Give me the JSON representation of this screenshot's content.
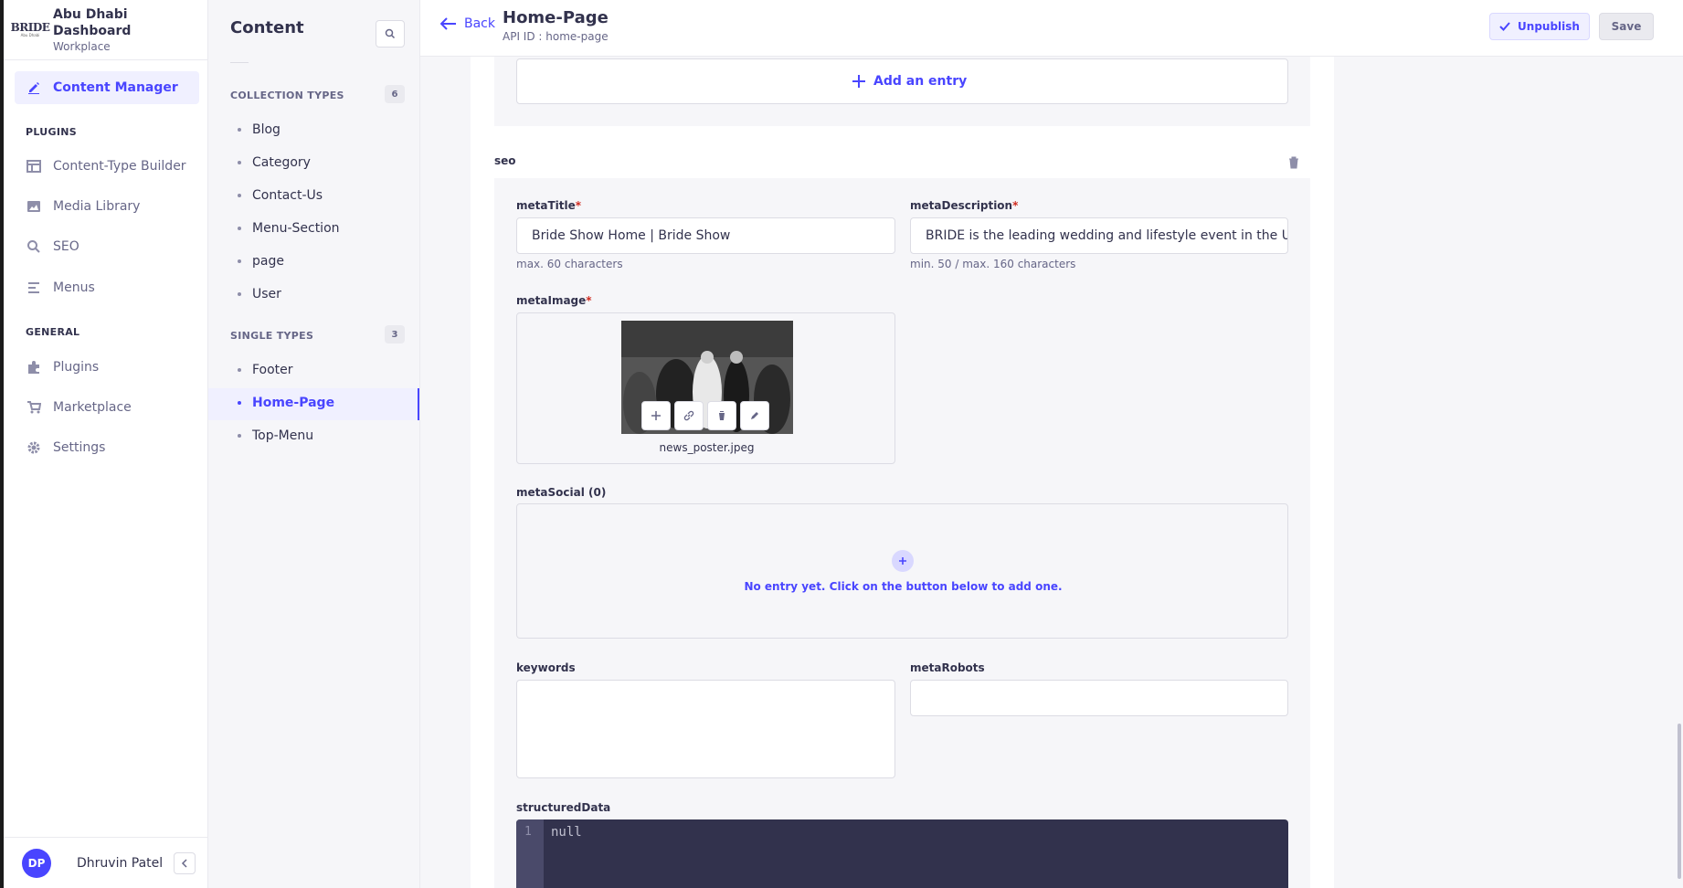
{
  "brand": {
    "logo_main": "BRIDE",
    "logo_sub": "Abu Dhabi",
    "title": "Abu Dhabi Dashboard",
    "subtitle": "Workplace"
  },
  "mainnav": {
    "active": "Content Manager",
    "plugins_heading": "PLUGINS",
    "plugins": [
      "Content-Type Builder",
      "Media Library",
      "SEO",
      "Menus"
    ],
    "general_heading": "GENERAL",
    "general": [
      "Plugins",
      "Marketplace",
      "Settings"
    ]
  },
  "user": {
    "initials": "DP",
    "name": "Dhruvin Patel"
  },
  "subnav": {
    "title": "Content",
    "collection_heading": "COLLECTION TYPES",
    "collection_count": "6",
    "collection_items": [
      "Blog",
      "Category",
      "Contact-Us",
      "Menu-Section",
      "page",
      "User"
    ],
    "single_heading": "SINGLE TYPES",
    "single_count": "3",
    "single_items": [
      "Footer",
      "Home-Page",
      "Top-Menu"
    ]
  },
  "header": {
    "back": "Back",
    "title": "Home-Page",
    "api_id": "API ID : home-page",
    "unpublish": "Unpublish",
    "save": "Save"
  },
  "editor": {
    "add_entry": "Add an entry",
    "seo_label": "seo",
    "meta_title_label": "metaTitle",
    "meta_title_value": "Bride Show Home | Bride Show",
    "meta_title_hint": "max. 60 characters",
    "meta_desc_label": "metaDescription",
    "meta_desc_value": "BRIDE is the leading wedding and lifestyle event in the UAE,",
    "meta_desc_hint": "min. 50 / max. 160 characters",
    "meta_image_label": "metaImage",
    "meta_image_filename": "news_poster.jpeg",
    "meta_social_label": "metaSocial (0)",
    "meta_social_empty": "No entry yet. Click on the button below to add one.",
    "keywords_label": "keywords",
    "meta_robots_label": "metaRobots",
    "structured_label": "structuredData",
    "code_line": "1",
    "code_value": "null"
  },
  "colors": {
    "accent": "#4945ff",
    "accent_light": "#f0f0ff",
    "required": "#d02b20"
  }
}
